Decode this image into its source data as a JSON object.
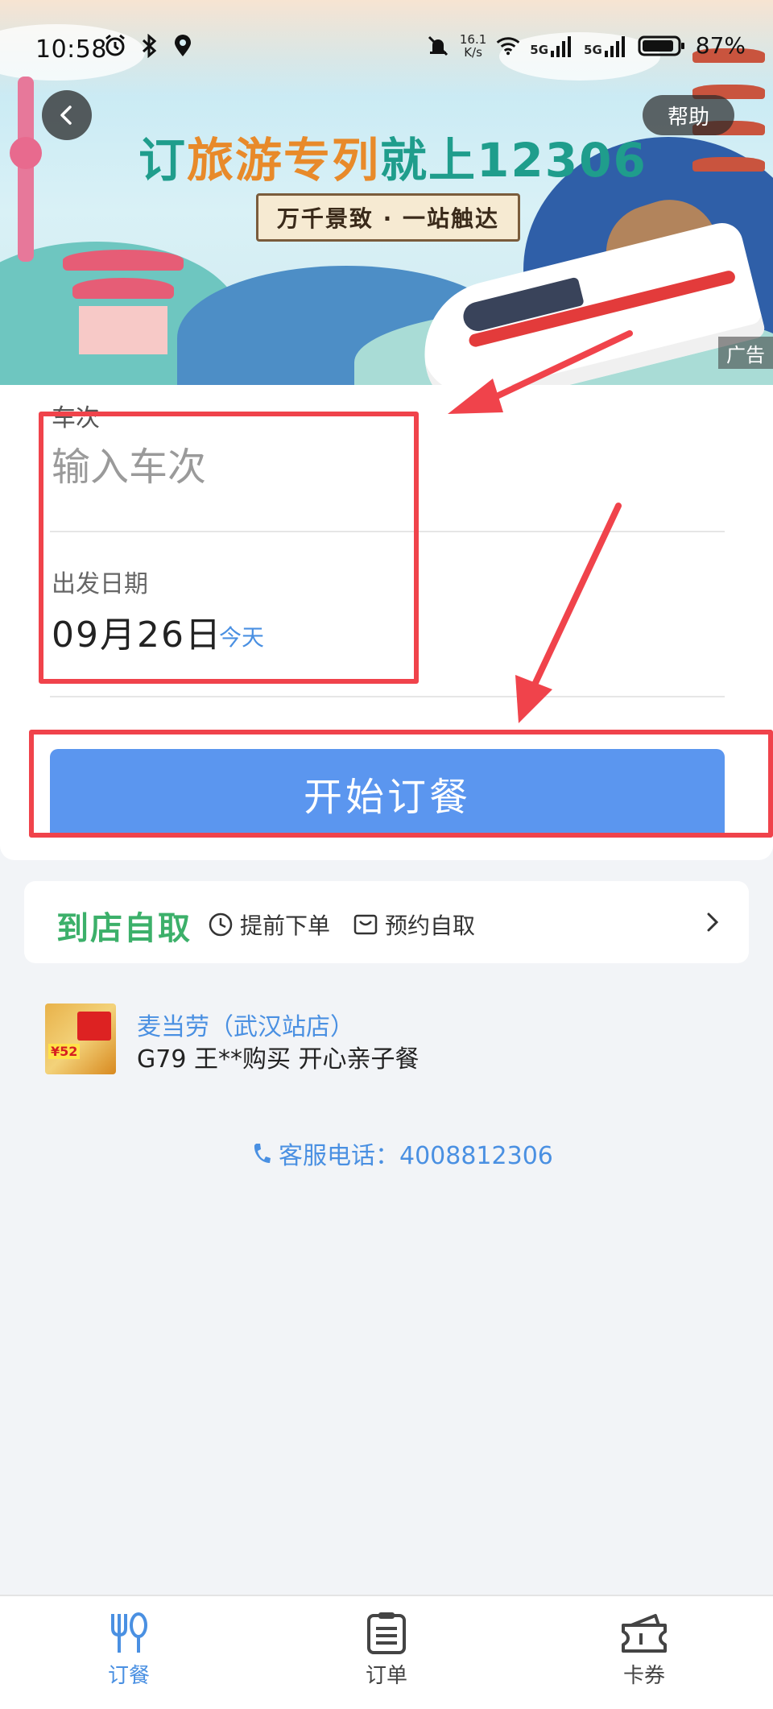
{
  "status_bar": {
    "time": "10:58",
    "net_speed_value": "16.1",
    "net_speed_unit": "K/s",
    "signal_1": "5G",
    "signal_2": "5G",
    "battery": "87%"
  },
  "banner": {
    "title_part1": "订",
    "title_part2": "旅游专列",
    "title_part3": "就上12306",
    "subtitle": "万千景致 · 一站触达",
    "ad_tag": "广告",
    "help_label": "帮助"
  },
  "form": {
    "train_label": "车次",
    "train_placeholder": "输入车次",
    "date_label": "出发日期",
    "date_value": "09月26日",
    "date_today": "今天",
    "start_button": "开始订餐"
  },
  "pickup": {
    "title": "到店自取",
    "feature_1": "提前下单",
    "feature_2": "预约自取"
  },
  "feed": {
    "store": "麦当劳（武汉站店）",
    "description": "G79 王**购买 开心亲子餐",
    "thumb_badge": "¥52"
  },
  "hotline": {
    "text": "客服电话：4008812306"
  },
  "bottom_nav": {
    "items": [
      {
        "label": "订餐",
        "icon": "cutlery-icon",
        "active": true
      },
      {
        "label": "订单",
        "icon": "order-list-icon",
        "active": false
      },
      {
        "label": "卡券",
        "icon": "coupon-icon",
        "active": false
      }
    ]
  },
  "colors": {
    "primary": "#5b96ef",
    "link": "#4a90e2",
    "pickup_green": "#3cb06a",
    "annotation_red": "#f0434b"
  }
}
